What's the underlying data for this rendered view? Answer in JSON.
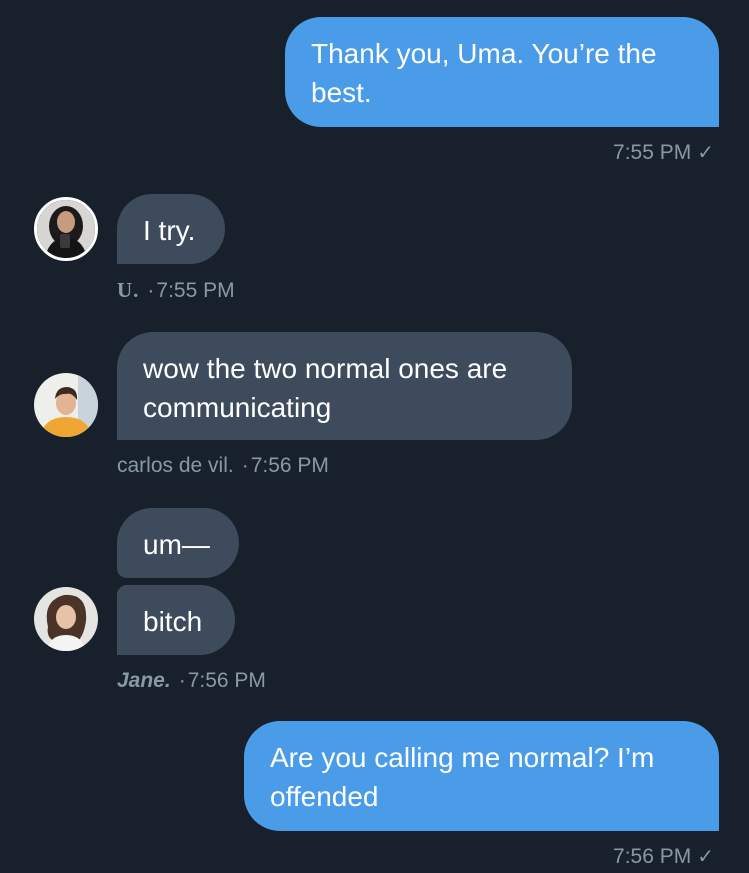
{
  "messages": [
    {
      "text": "Thank you, Uma. You’re the\nbest.",
      "time": "7:55 PM",
      "status_icon": "✓"
    },
    {
      "text": "I try.",
      "sender": "U.",
      "time": "7:55 PM"
    },
    {
      "text": "wow the two normal ones are\ncommunicating",
      "sender": "carlos de vil.",
      "time": "7:56 PM"
    },
    {
      "text": "um—",
      "sender": "Jane.",
      "time": "7:56 PM"
    },
    {
      "text": "bitch",
      "sender": "Jane.",
      "time": "7:56 PM"
    },
    {
      "text": "Are you calling me normal? I’m\noffended",
      "time": "7:56 PM",
      "status_icon": "✓"
    }
  ],
  "separator": "·",
  "colors": {
    "background": "#18202b",
    "outgoing_bubble": "#4a9ce8",
    "incoming_bubble": "#3d4b5c",
    "meta_text": "#8899a6"
  }
}
